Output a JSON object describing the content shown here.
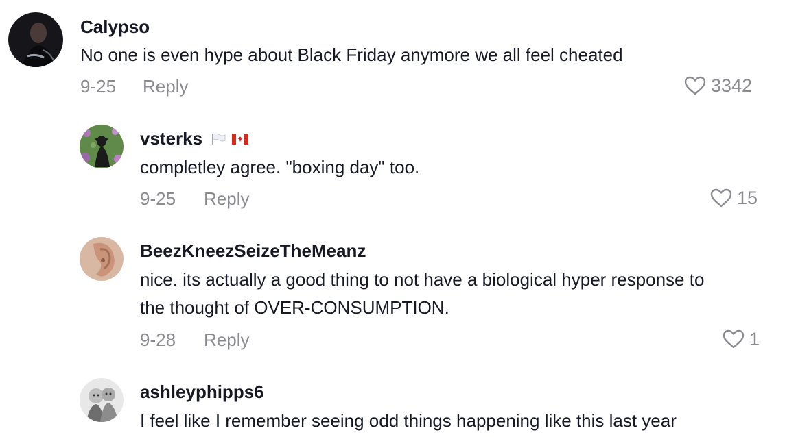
{
  "comments": [
    {
      "username": "Calypso",
      "text": "No one is even hype about Black Friday anymore we all feel cheated",
      "date": "9-25",
      "reply_label": "Reply",
      "likes": "3342"
    },
    {
      "username": "vsterks",
      "text": "completley agree. \"boxing day\" too.",
      "date": "9-25",
      "reply_label": "Reply",
      "likes": "15"
    },
    {
      "username": "BeezKneezSeizeTheMeanz",
      "text": "nice. its actually a good thing to not have a biological hyper response to the thought of OVER-CONSUMPTION.",
      "date": "9-28",
      "reply_label": "Reply",
      "likes": "1"
    },
    {
      "username": "ashleyphipps6",
      "text": "I feel like I remember seeing odd things happening like this last year",
      "date": "",
      "reply_label": "",
      "likes": ""
    }
  ],
  "icons": {
    "like": "heart-outline-icon",
    "flags": [
      "white-flag-icon",
      "canada-flag-icon"
    ]
  },
  "colors": {
    "text": "#161823",
    "muted": "#8a8b91",
    "background": "#ffffff"
  }
}
